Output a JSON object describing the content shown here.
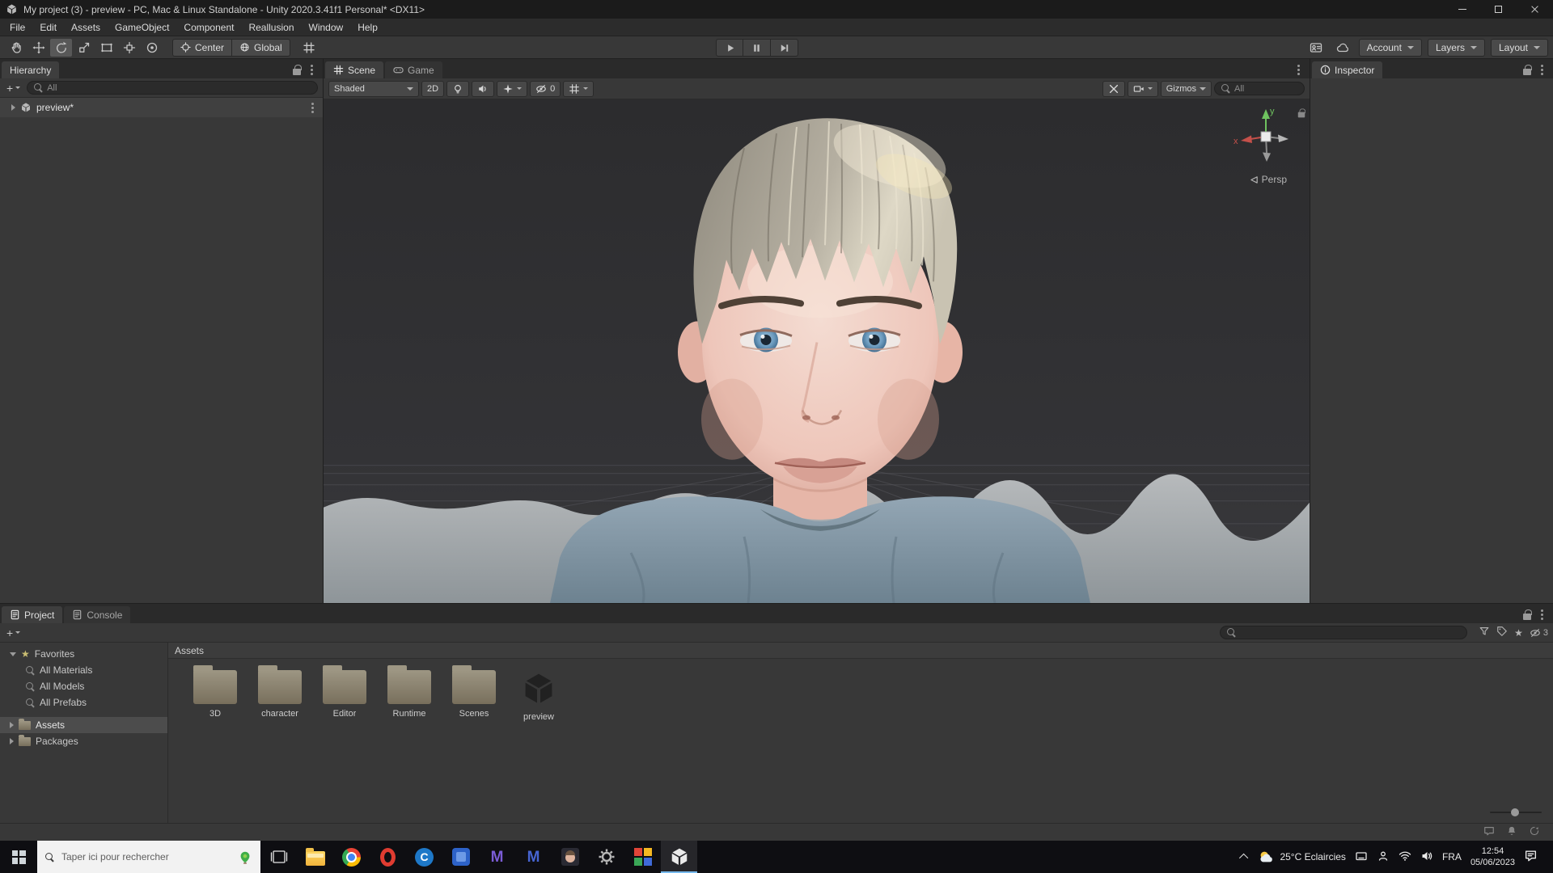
{
  "window": {
    "title": "My project (3) - preview - PC, Mac & Linux Standalone - Unity 2020.3.41f1 Personal* <DX11>"
  },
  "menubar": {
    "items": [
      "File",
      "Edit",
      "Assets",
      "GameObject",
      "Component",
      "Reallusion",
      "Window",
      "Help"
    ]
  },
  "toolbar": {
    "pivot": "Center",
    "space": "Global",
    "account": "Account",
    "layers": "Layers",
    "layout": "Layout"
  },
  "hierarchy": {
    "tab": "Hierarchy",
    "add": "+",
    "search": "All",
    "scene_name": "preview*"
  },
  "scene": {
    "tab_scene": "Scene",
    "tab_game": "Game",
    "draw_mode": "Shaded",
    "mode_2d": "2D",
    "hidden": "0",
    "gizmos": "Gizmos",
    "search": "All",
    "persp": "Persp",
    "axis_x": "x",
    "axis_y": "y"
  },
  "inspector": {
    "tab": "Inspector"
  },
  "project": {
    "tab_project": "Project",
    "tab_console": "Console",
    "add": "+",
    "favorites": "Favorites",
    "fav_items": [
      "All Materials",
      "All Models",
      "All Prefabs"
    ],
    "assets": "Assets",
    "packages": "Packages",
    "location": "Assets",
    "folders": [
      "3D",
      "character",
      "Editor",
      "Runtime",
      "Scenes"
    ],
    "scene_asset": "preview",
    "hidden": "3"
  },
  "taskbar": {
    "search_placeholder": "Taper ici pour rechercher",
    "apps": {
      "c_label": "C",
      "m_purple_label": "M",
      "m_blue_label": "M"
    },
    "weather": "25°C Eclaircies",
    "lang": "FRA",
    "time": "12:54",
    "date": "05/06/2023"
  },
  "colors": {
    "axis_x": "#c4504a",
    "axis_y": "#6fc25f",
    "taskbar_active": "#76b9ed"
  }
}
